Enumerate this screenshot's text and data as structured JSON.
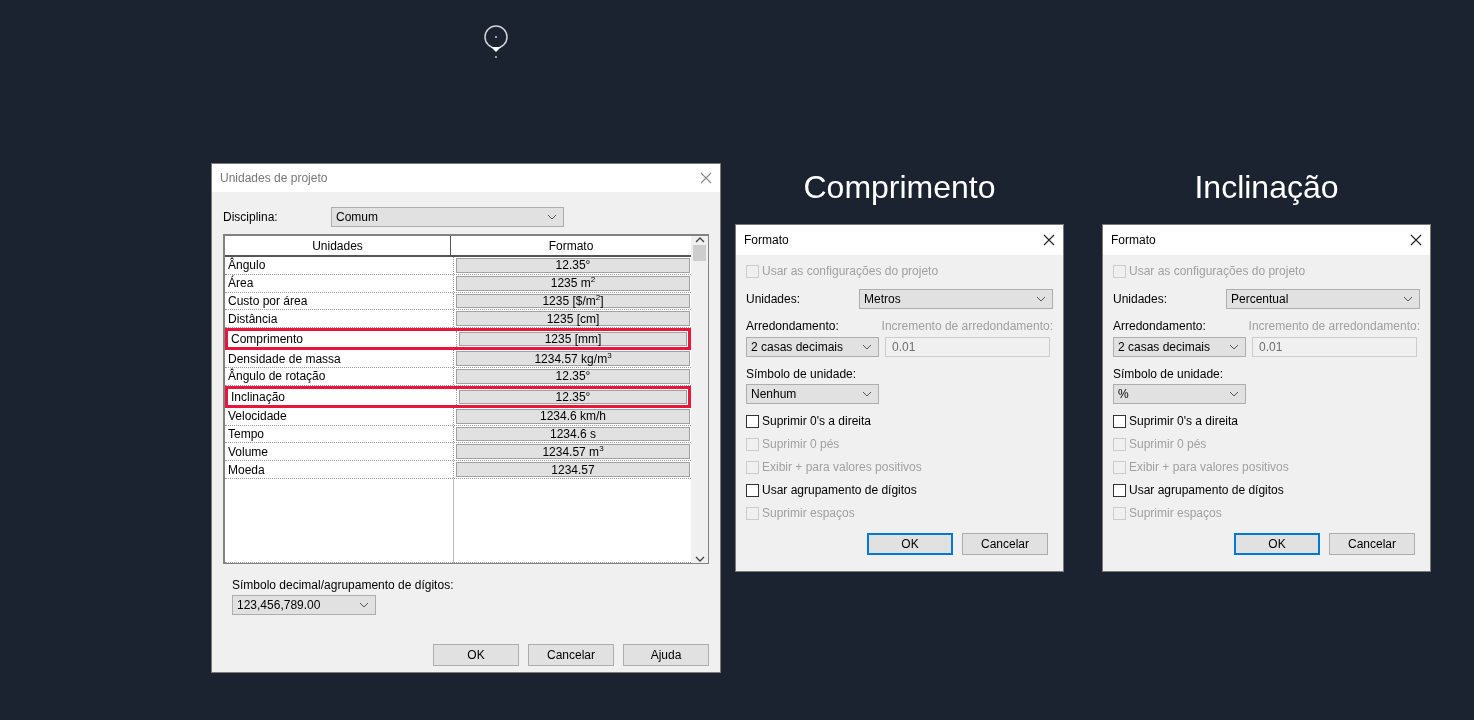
{
  "project_units_dialog": {
    "title": "Unidades de projeto",
    "discipline": {
      "label": "Disciplina:",
      "value": "Comum"
    },
    "table": {
      "columns": [
        "Unidades",
        "Formato"
      ],
      "rows": [
        {
          "unit": "Ângulo",
          "format": "12.35°",
          "highlighted": false
        },
        {
          "unit": "Área",
          "format": "1235 m$^{2}$",
          "highlighted": false
        },
        {
          "unit": "Custo por área",
          "format": "1235 [$/m$^{2}$]",
          "highlighted": false
        },
        {
          "unit": "Distância",
          "format": "1235 [cm]",
          "highlighted": false
        },
        {
          "unit": "Comprimento",
          "format": "1235 [mm]",
          "highlighted": true
        },
        {
          "unit": "Densidade de massa",
          "format": "1234.57 kg/m$^{3}$",
          "highlighted": false
        },
        {
          "unit": "Ângulo de rotação",
          "format": "12.35°",
          "highlighted": false
        },
        {
          "unit": "Inclinação",
          "format": "12.35°",
          "highlighted": true
        },
        {
          "unit": "Velocidade",
          "format": "1234.6 km/h",
          "highlighted": false
        },
        {
          "unit": "Tempo",
          "format": "1234.6 s",
          "highlighted": false
        },
        {
          "unit": "Volume",
          "format": "1234.57 m$^{3}$",
          "highlighted": false
        },
        {
          "unit": "Moeda",
          "format": "1234.57",
          "highlighted": false
        }
      ]
    },
    "decimal_symbol": {
      "label": "Símbolo decimal/agrupamento de dígitos:",
      "value": "123,456,789.00"
    },
    "buttons": [
      {
        "label": "OK"
      },
      {
        "label": "Cancelar"
      },
      {
        "label": "Ajuda"
      }
    ]
  },
  "format_dialogs": [
    {
      "heading": "Comprimento",
      "title": "Formato",
      "use_project_settings": {
        "label": "Usar as configurações do projeto",
        "checked": false,
        "disabled": true
      },
      "units": {
        "label": "Unidades:",
        "value": "Metros"
      },
      "rounding": {
        "label": "Arredondamento:",
        "value": "2 casas decimais"
      },
      "rounding_increment": {
        "label": "Incremento de arredondamento:",
        "value": "0.01",
        "disabled": true
      },
      "unit_symbol": {
        "label": "Símbolo de unidade:",
        "value": "Nenhum"
      },
      "options": [
        {
          "label": "Suprimir 0's a direita",
          "checked": false,
          "disabled": false
        },
        {
          "label": "Suprimir 0 pés",
          "checked": false,
          "disabled": true
        },
        {
          "label": "Exibir + para valores positivos",
          "checked": false,
          "disabled": true
        },
        {
          "label": "Usar agrupamento de dígitos",
          "checked": false,
          "disabled": false
        },
        {
          "label": "Suprimir espaços",
          "checked": false,
          "disabled": true
        }
      ],
      "buttons": [
        {
          "label": "OK",
          "focused": true
        },
        {
          "label": "Cancelar",
          "focused": false
        }
      ]
    },
    {
      "heading": "Inclinação",
      "title": "Formato",
      "use_project_settings": {
        "label": "Usar as configurações do projeto",
        "checked": false,
        "disabled": true
      },
      "units": {
        "label": "Unidades:",
        "value": "Percentual"
      },
      "rounding": {
        "label": "Arredondamento:",
        "value": "2 casas decimais"
      },
      "rounding_increment": {
        "label": "Incremento de arredondamento:",
        "value": "0.01",
        "disabled": true
      },
      "unit_symbol": {
        "label": "Símbolo de unidade:",
        "value": "%"
      },
      "options": [
        {
          "label": "Suprimir 0's a direita",
          "checked": false,
          "disabled": false
        },
        {
          "label": "Suprimir 0 pés",
          "checked": false,
          "disabled": true
        },
        {
          "label": "Exibir + para valores positivos",
          "checked": false,
          "disabled": true
        },
        {
          "label": "Usar agrupamento de dígitos",
          "checked": false,
          "disabled": false
        },
        {
          "label": "Suprimir espaços",
          "checked": false,
          "disabled": true
        }
      ],
      "buttons": [
        {
          "label": "OK",
          "focused": true
        },
        {
          "label": "Cancelar",
          "focused": false
        }
      ]
    }
  ]
}
